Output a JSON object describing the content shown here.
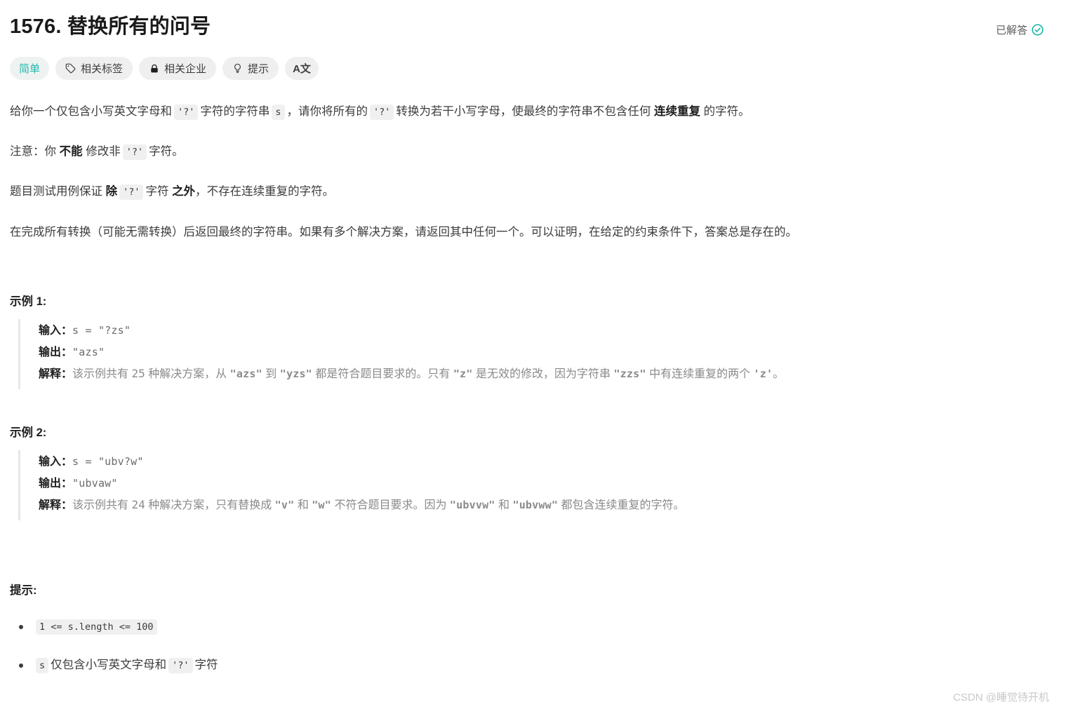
{
  "header": {
    "title": "1576. 替换所有的问号",
    "status_label": "已解答",
    "status_color": "#00af9b"
  },
  "tags": [
    {
      "label": "简单",
      "icon": "",
      "kind": "difficulty"
    },
    {
      "label": "相关标签",
      "icon": "tag-icon",
      "kind": "normal"
    },
    {
      "label": "相关企业",
      "icon": "lock-icon",
      "kind": "normal"
    },
    {
      "label": "提示",
      "icon": "lightbulb-icon",
      "kind": "normal"
    },
    {
      "label": "A文",
      "icon": "translate-icon",
      "kind": "icon-only"
    }
  ],
  "description": {
    "p1_a": "给你一个仅包含小写英文字母和",
    "p1_code1": "'?'",
    "p1_b": "字符的字符串",
    "p1_code2": "s",
    "p1_c": "，请你将所有的",
    "p1_code3": "'?'",
    "p1_d": "转换为若干小写字母，使最终的字符串不包含任何",
    "p1_bold": "连续重复",
    "p1_e": "的字符。",
    "p2_a": "注意：你",
    "p2_bold1": "不能",
    "p2_b": "修改非",
    "p2_code1": "'?'",
    "p2_c": "字符。",
    "p3_a": "题目测试用例保证",
    "p3_bold1": "除",
    "p3_code1": "'?'",
    "p3_b": "字符",
    "p3_bold2": "之外",
    "p3_c": "，不存在连续重复的字符。",
    "p4": "在完成所有转换（可能无需转换）后返回最终的字符串。如果有多个解决方案，请返回其中任何一个。可以证明，在给定的约束条件下，答案总是存在的。"
  },
  "examples": [
    {
      "heading": "示例 1:",
      "input_label": "输入：",
      "input_value": "s = \"?zs\"",
      "output_label": "输出：",
      "output_value": "\"azs\"",
      "explain_label": "解释：",
      "explain_a": "该示例共有",
      "explain_n1": "25",
      "explain_b": "种解决方案，从",
      "explain_c1": "\"azs\"",
      "explain_c": "到",
      "explain_c2": "\"yzs\"",
      "explain_d": "都是符合题目要求的。只有",
      "explain_c3": "\"z\"",
      "explain_e": "是无效的修改，因为字符串",
      "explain_c4": "\"zzs\"",
      "explain_f": "中有连续重复的两个",
      "explain_c5": "'z'",
      "explain_g": "。"
    },
    {
      "heading": "示例 2:",
      "input_label": "输入：",
      "input_value": "s = \"ubv?w\"",
      "output_label": "输出：",
      "output_value": "\"ubvaw\"",
      "explain_label": "解释：",
      "explain_a": "该示例共有",
      "explain_n1": "24",
      "explain_b": "种解决方案，只有替换成",
      "explain_c1": "\"v\"",
      "explain_c": "和",
      "explain_c2": "\"w\"",
      "explain_d": "不符合题目要求。因为",
      "explain_c3": "\"ubvvw\"",
      "explain_e": "和",
      "explain_c4": "\"ubvww\"",
      "explain_f": "都包含连续重复的字符。",
      "explain_c5": "",
      "explain_g": ""
    }
  ],
  "hints": {
    "heading": "提示:",
    "item1_code": "1 <= s.length <= 100",
    "item2_code": "s",
    "item2_text_a": "仅包含小写英文字母和",
    "item2_code2": "'?'",
    "item2_text_b": "字符"
  },
  "watermark": "CSDN @睡觉待开机"
}
